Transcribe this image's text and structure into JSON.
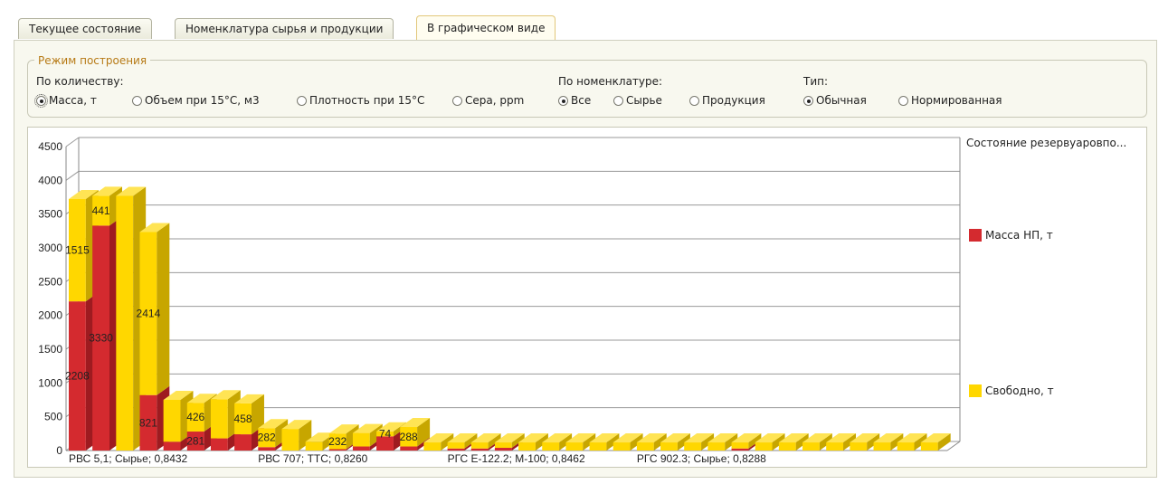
{
  "tabs": [
    {
      "label": "Текущее состояние"
    },
    {
      "label": "Номенклатура сырья и продукции"
    },
    {
      "label": "В графическом виде"
    }
  ],
  "mode": {
    "title": "Режим построения",
    "quantity_label": "По количеству:",
    "quantity_options": [
      "Масса, т",
      "Объем  при 15°C, м3",
      "Плотность при 15°C",
      "Сера, ppm"
    ],
    "quantity_selected": "Масса, т",
    "nomenclature_label": "По номенклатуре:",
    "nomenclature_options": [
      "Все",
      "Сырье",
      "Продукция"
    ],
    "nomenclature_selected": "Все",
    "type_label": "Тип:",
    "type_options": [
      "Обычная",
      "Нормированная"
    ],
    "type_selected": "Обычная"
  },
  "colors": {
    "mass": "#d42a2f",
    "free": "#ffd700",
    "free_side": "#c7a600",
    "mass_side": "#9e1b20"
  },
  "chart_data": {
    "type": "bar",
    "stacked": true,
    "three_d": true,
    "title": "Состояние  резервуаровпо...",
    "ylim": [
      0,
      4500
    ],
    "yticks": [
      0,
      500,
      1000,
      1500,
      2000,
      2500,
      3000,
      3500,
      4000,
      4500
    ],
    "x_tick_labels": [
      "РВС 5,1; Сырье; 0,8432",
      "РВС 707; ТТС; 0,8260",
      "РГС Е-122.2; М-100; 0,8462",
      "РГС 902.3; Сырье; 0,8288"
    ],
    "grid": true,
    "legend_position": "right",
    "series": [
      {
        "name": "Масса НП, т",
        "values": [
          2208,
          3330,
          0,
          821,
          130,
          281,
          180,
          240,
          50,
          0,
          0,
          20,
          60,
          210,
          60,
          0,
          30,
          30,
          40,
          0,
          0,
          0,
          0,
          0,
          0,
          0,
          0,
          0,
          30,
          0,
          0,
          0,
          0,
          0,
          0,
          0,
          0
        ],
        "labels": [
          "2208",
          "3330",
          "",
          "821",
          "",
          "281",
          "",
          "",
          "",
          "",
          "",
          "",
          "",
          "",
          "",
          "",
          "",
          "",
          "",
          "",
          "",
          "",
          "",
          "",
          "",
          "",
          "",
          "",
          "",
          "",
          "",
          "",
          "",
          "",
          "",
          "",
          ""
        ]
      },
      {
        "name": "Свободно, т",
        "values": [
          1515,
          441,
          3770,
          2414,
          620,
          426,
          580,
          458,
          282,
          320,
          130,
          232,
          200,
          74,
          288,
          120,
          90,
          90,
          80,
          120,
          120,
          120,
          120,
          120,
          120,
          120,
          120,
          120,
          90,
          120,
          120,
          120,
          120,
          120,
          120,
          120,
          120
        ],
        "labels": [
          "1515",
          "441",
          "",
          "2414",
          "",
          "426",
          "",
          "458",
          "282",
          "",
          "",
          "232",
          "",
          "74",
          "288",
          "",
          "",
          "",
          "",
          "",
          "",
          "",
          "",
          "",
          "",
          "",
          "",
          "",
          "",
          "",
          "",
          "",
          "",
          "",
          "",
          "",
          ""
        ]
      }
    ]
  }
}
